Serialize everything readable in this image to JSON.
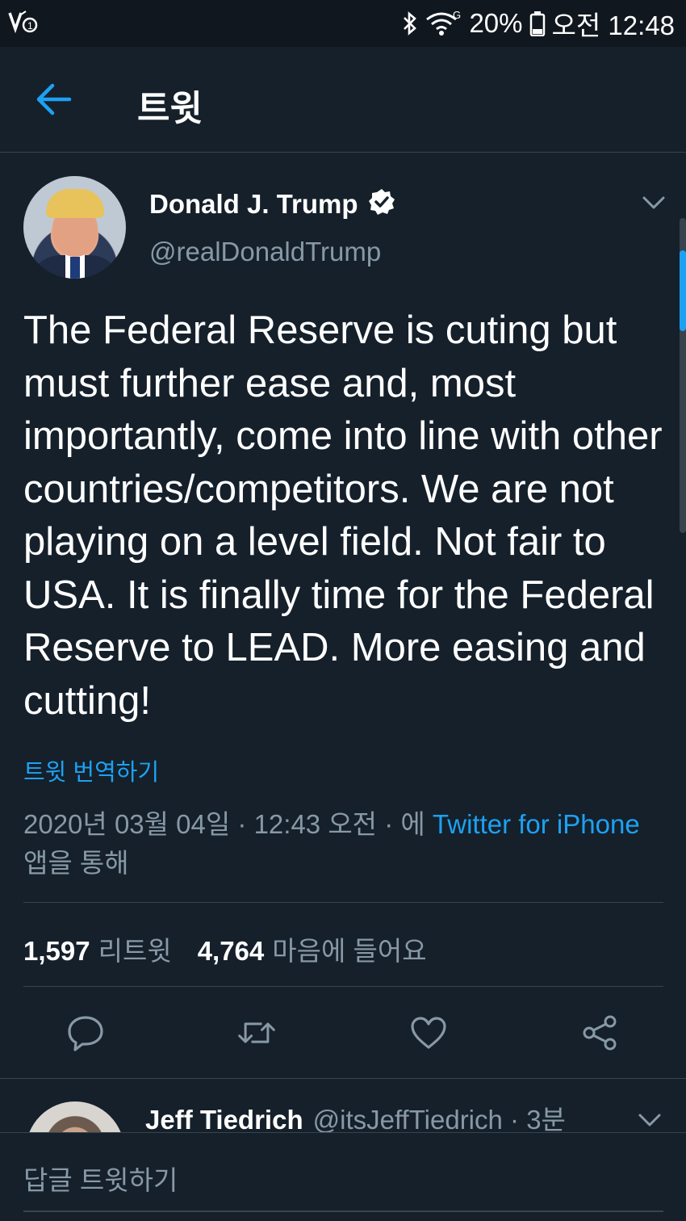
{
  "status_bar": {
    "battery": "20%",
    "time": "오전 12:48",
    "network_label": "G"
  },
  "header": {
    "title": "트윗"
  },
  "tweet": {
    "display_name": "Donald J. Trump",
    "handle": "@realDonaldTrump",
    "text": "The Federal Reserve is cuting  but must further ease and, most importantly, come into line with other countries/competitors. We are not playing on a level field. Not fair to USA. It is finally time for the Federal Reserve to LEAD. More easing and cutting!",
    "translate_label": "트윗 번역하기",
    "timestamp": "2020년 03월 04일 · 12:43 오전 · 에",
    "source_link": "Twitter for iPhone",
    "source_suffix": "앱을 통해",
    "retweet_count": "1,597",
    "retweet_label": "리트윗",
    "like_count": "4,764",
    "like_label": "마음에 들어요"
  },
  "reply": {
    "name": "Jeff Tiedrich",
    "handle_time": "@itsJeffTiedrich · 3분"
  },
  "compose": {
    "placeholder": "답글 트윗하기"
  },
  "colors": {
    "background": "#15202b",
    "accent": "#1da1f2",
    "secondary_text": "#8899a6",
    "divider": "#38444d"
  }
}
